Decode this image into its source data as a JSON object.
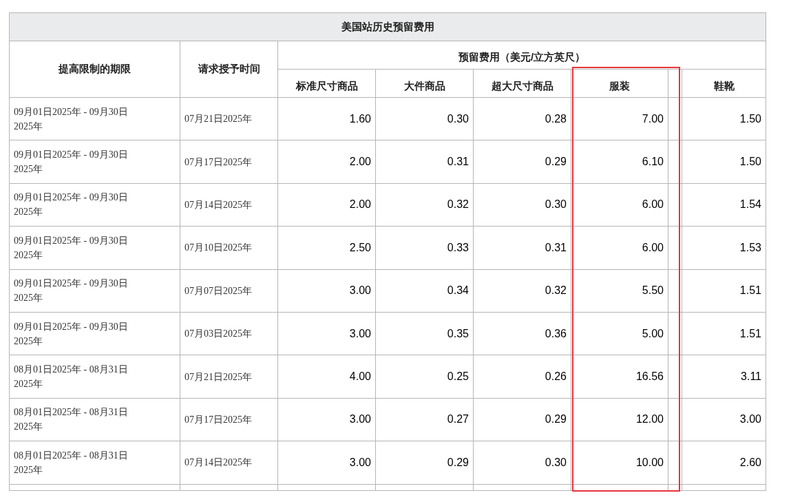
{
  "table": {
    "title": "美国站历史预留费用",
    "columns": [
      "提高限制的期限",
      "请求授予时间"
    ],
    "group_header": "预留费用（美元/立方英尺）",
    "subcolumns": [
      {
        "label": "标准尺寸商品",
        "highlighted": false
      },
      {
        "label": "大件商品",
        "highlighted": false
      },
      {
        "label": "超大尺寸商品",
        "highlighted": false
      },
      {
        "label": "服装",
        "highlighted": true
      },
      {
        "label": "鞋靴",
        "highlighted": false
      }
    ],
    "rows": [
      {
        "period": "09月01日2025年 - 09月30日2025年",
        "granted": "07月21日2025年",
        "fees": [
          "1.60",
          "0.30",
          "0.28",
          "7.00",
          "1.50"
        ]
      },
      {
        "period": "09月01日2025年 - 09月30日2025年",
        "granted": "07月17日2025年",
        "fees": [
          "2.00",
          "0.31",
          "0.29",
          "6.10",
          "1.50"
        ]
      },
      {
        "period": "09月01日2025年 - 09月30日2025年",
        "granted": "07月14日2025年",
        "fees": [
          "2.00",
          "0.32",
          "0.30",
          "6.00",
          "1.54"
        ]
      },
      {
        "period": "09月01日2025年 - 09月30日2025年",
        "granted": "07月10日2025年",
        "fees": [
          "2.50",
          "0.33",
          "0.31",
          "6.00",
          "1.53"
        ]
      },
      {
        "period": "09月01日2025年 - 09月30日2025年",
        "granted": "07月07日2025年",
        "fees": [
          "3.00",
          "0.34",
          "0.32",
          "5.50",
          "1.51"
        ]
      },
      {
        "period": "09月01日2025年 - 09月30日2025年",
        "granted": "07月03日2025年",
        "fees": [
          "3.00",
          "0.35",
          "0.36",
          "5.00",
          "1.51"
        ]
      },
      {
        "period": "08月01日2025年 - 08月31日2025年",
        "granted": "07月21日2025年",
        "fees": [
          "4.00",
          "0.25",
          "0.26",
          "16.56",
          "3.11"
        ]
      },
      {
        "period": "08月01日2025年 - 08月31日2025年",
        "granted": "07月17日2025年",
        "fees": [
          "3.00",
          "0.27",
          "0.29",
          "12.00",
          "3.00"
        ]
      },
      {
        "period": "08月01日2025年 - 08月31日2025年",
        "granted": "07月14日2025年",
        "fees": [
          "3.00",
          "0.29",
          "0.30",
          "10.00",
          "2.60"
        ]
      }
    ]
  }
}
